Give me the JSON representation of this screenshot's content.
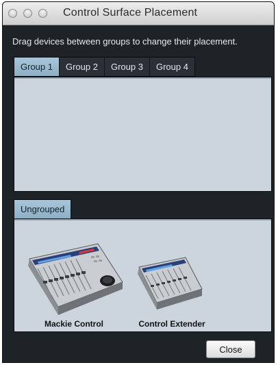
{
  "window": {
    "title": "Control Surface Placement"
  },
  "instruction": "Drag devices between groups to change their placement.",
  "group_tabs": [
    {
      "label": "Group 1",
      "active": true
    },
    {
      "label": "Group 2",
      "active": false
    },
    {
      "label": "Group 3",
      "active": false
    },
    {
      "label": "Group 4",
      "active": false
    }
  ],
  "ungrouped": {
    "tab_label": "Ungrouped",
    "devices": [
      {
        "label": "Mackie Control",
        "icon": "mackie-control-icon"
      },
      {
        "label": "Control Extender",
        "icon": "control-extender-icon"
      }
    ]
  },
  "footer": {
    "close_label": "Close"
  },
  "colors": {
    "window_bg": "#1e2328",
    "panel_bg": "#ccd5dd",
    "active_tab": "#9bbad0"
  }
}
